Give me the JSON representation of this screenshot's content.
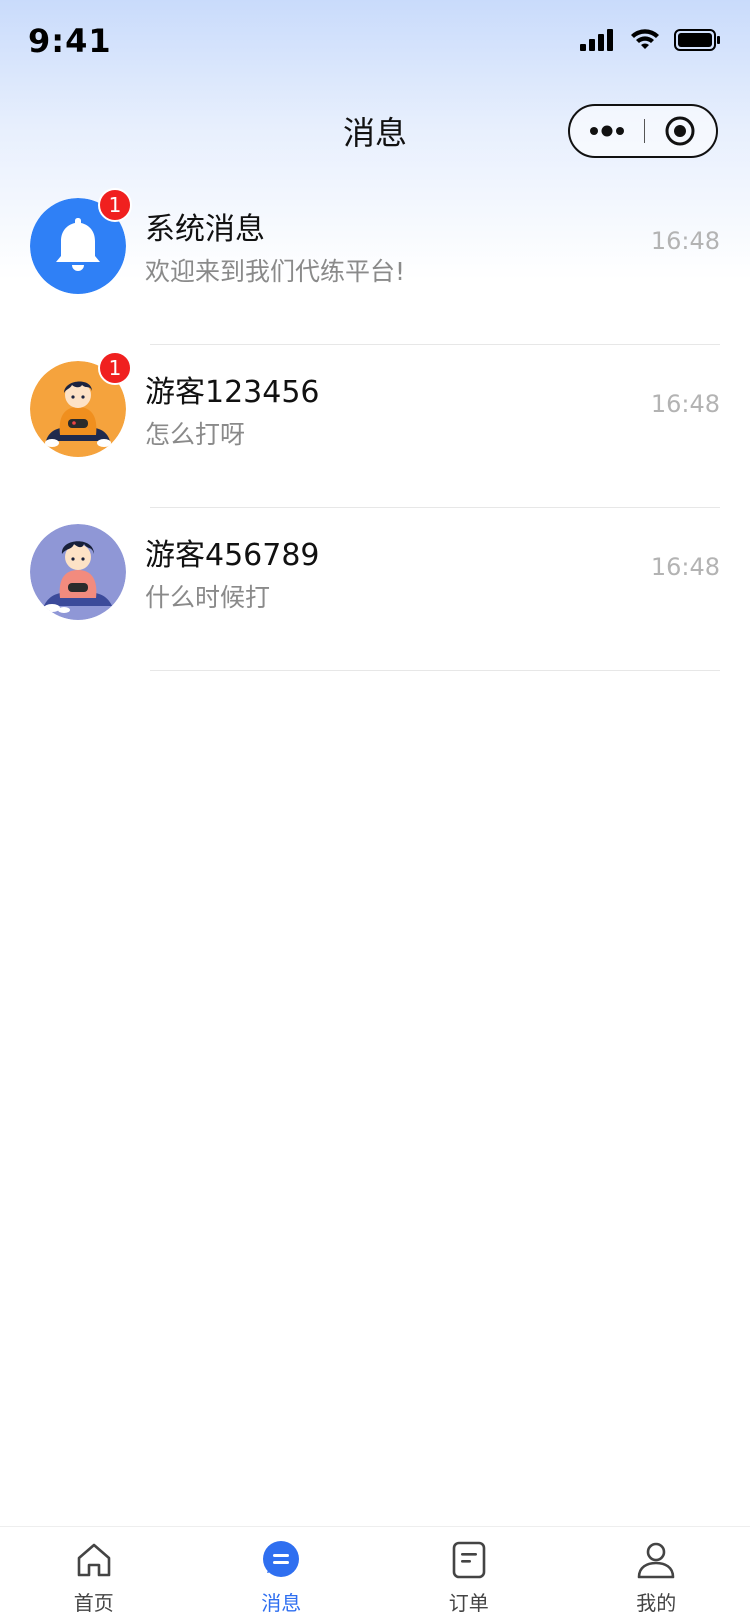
{
  "status_bar": {
    "time": "9:41"
  },
  "nav": {
    "title": "消息"
  },
  "messages": [
    {
      "name": "系统消息",
      "preview": "欢迎来到我们代练平台!",
      "time": "16:48",
      "unread": "1",
      "avatar": "bell-icon"
    },
    {
      "name": "游客123456",
      "preview": "怎么打呀",
      "time": "16:48",
      "unread": "1",
      "avatar": "gamer-avatar-orange"
    },
    {
      "name": "游客456789",
      "preview": "什么时候打",
      "time": "16:48",
      "unread": "",
      "avatar": "gamer-avatar-purple"
    }
  ],
  "tabbar": {
    "tabs": [
      {
        "label": "首页",
        "icon": "home-icon",
        "active": false
      },
      {
        "label": "消息",
        "icon": "chat-icon",
        "active": true
      },
      {
        "label": "订单",
        "icon": "order-icon",
        "active": false
      },
      {
        "label": "我的",
        "icon": "profile-icon",
        "active": false
      }
    ]
  },
  "colors": {
    "accent": "#2f6ff0",
    "badge": "#f0201f",
    "bell_avatar": "#2f80f6",
    "orange_avatar": "#f5a33d",
    "purple_avatar": "#8f97d6"
  }
}
